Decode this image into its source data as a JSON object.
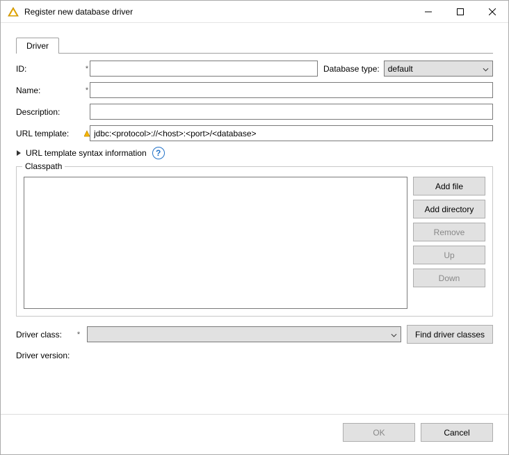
{
  "window": {
    "title": "Register new database driver"
  },
  "tab": {
    "label": "Driver"
  },
  "form": {
    "id_label": "ID:",
    "id_value": "",
    "dbtype_label": "Database type:",
    "dbtype_value": "default",
    "name_label": "Name:",
    "name_value": "",
    "desc_label": "Description:",
    "desc_value": "",
    "urltpl_label": "URL template:",
    "urltpl_value": "jdbc:<protocol>://<host>:<port>/<database>",
    "syntax_info": "URL template syntax information"
  },
  "classpath": {
    "legend": "Classpath",
    "buttons": {
      "add_file": "Add file",
      "add_dir": "Add directory",
      "remove": "Remove",
      "up": "Up",
      "down": "Down"
    }
  },
  "driverclass": {
    "label": "Driver class:",
    "value": "",
    "find_label": "Find driver classes"
  },
  "driverversion": {
    "label": "Driver version:"
  },
  "footer": {
    "ok": "OK",
    "cancel": "Cancel"
  }
}
